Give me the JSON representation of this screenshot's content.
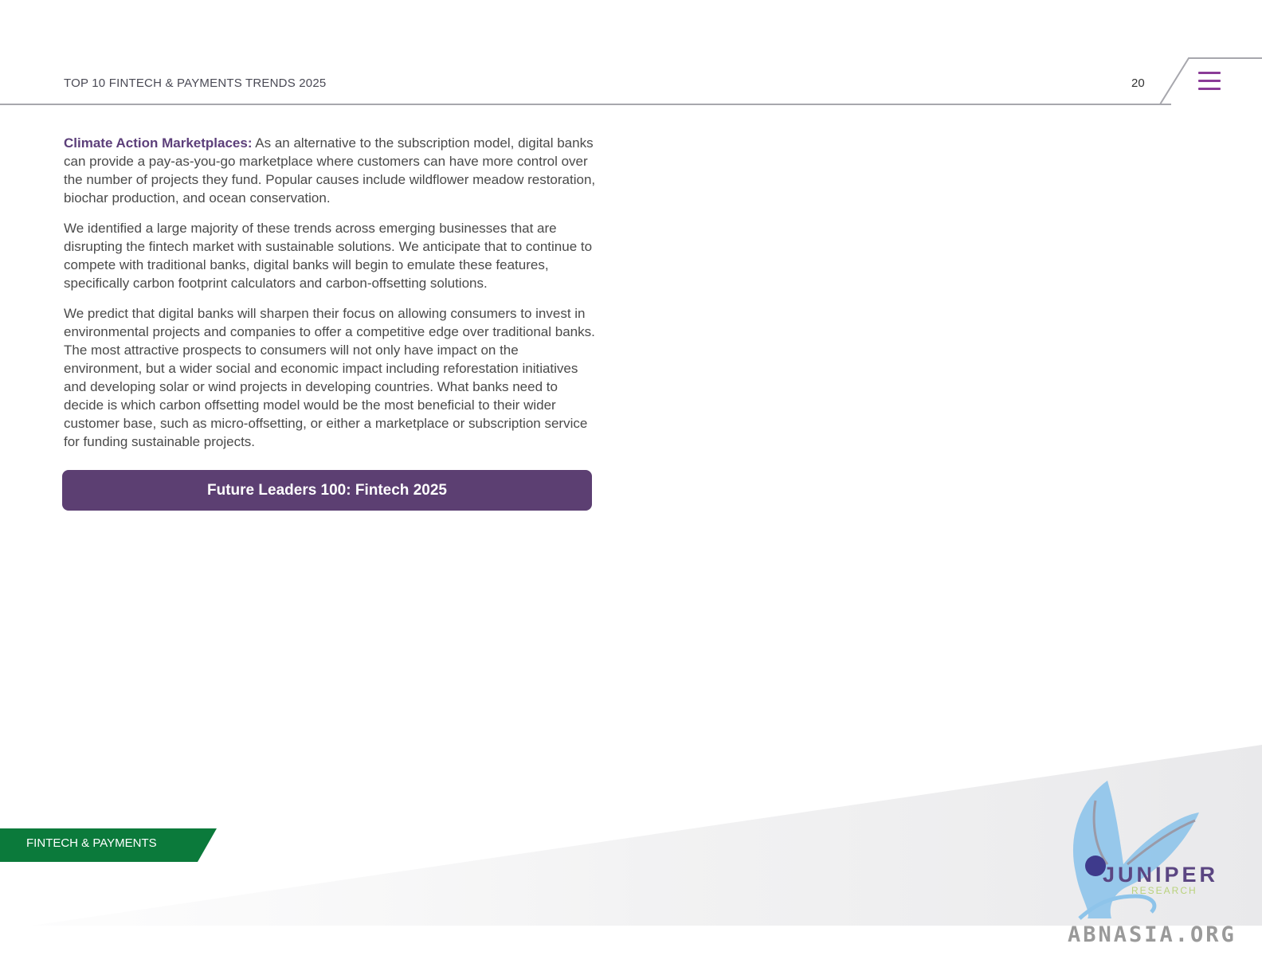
{
  "header": {
    "report_title": "TOP 10 FINTECH & PAYMENTS TRENDS 2025",
    "page_number": "20",
    "accent_color": "#8a3b97"
  },
  "content": {
    "para1_lead": "Climate Action Marketplaces:",
    "para1_body": " As an alternative to the subscription model, digital banks can provide a pay-as-you-go marketplace where customers can have more control over the number of projects they fund. Popular causes include wildflower meadow restoration, biochar production, and ocean conservation.",
    "para2": "We identified a large majority of these trends across emerging businesses that are disrupting the fintech market with sustainable solutions. We anticipate that to continue to compete with traditional banks, digital banks will begin to emulate these features, specifically carbon footprint calculators and carbon-offsetting solutions.",
    "para3": "We predict that digital banks will sharpen their focus on allowing consumers to invest in environmental projects and companies to offer a competitive edge over traditional banks. The most attractive prospects to consumers will not only have impact on the environment, but a wider social and economic impact including reforestation initiatives and developing solar or wind projects in developing countries. What banks need to decide is which carbon offsetting model would be the most beneficial to their wider customer base, such as micro-offsetting, or either a marketplace or subscription service for funding sustainable projects."
  },
  "cta": {
    "label": "Future Leaders 100: Fintech 2025",
    "color": "#5c3f72"
  },
  "footer": {
    "category": "FINTECH & PAYMENTS",
    "category_color": "#0b7a3b",
    "logo_word": "JUNIPER",
    "logo_sub": "RESEARCH",
    "watermark": "ABNASIA.ORG"
  }
}
